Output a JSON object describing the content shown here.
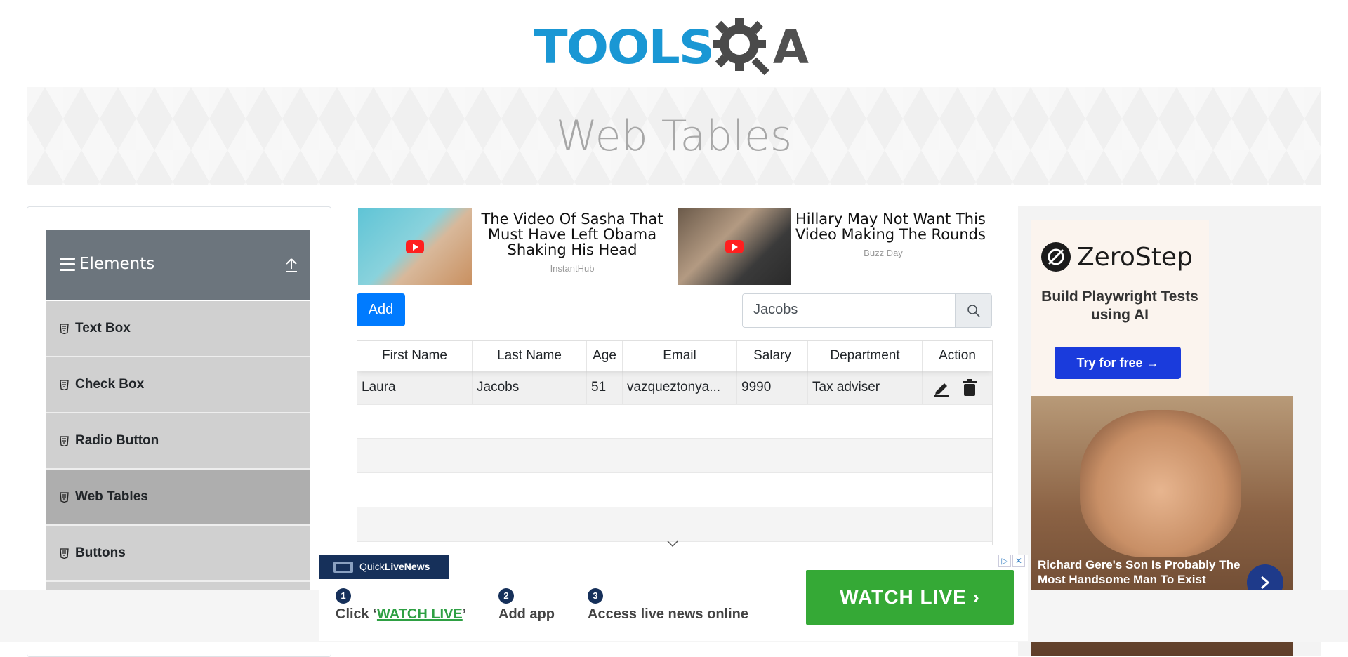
{
  "logo": {
    "text": "TOOLS",
    "suffix": "A"
  },
  "banner": {
    "title": "Web Tables"
  },
  "sidebar": {
    "group": {
      "title": "Elements"
    },
    "items": [
      {
        "label": "Text Box",
        "active": false
      },
      {
        "label": "Check Box",
        "active": false
      },
      {
        "label": "Radio Button",
        "active": false
      },
      {
        "label": "Web Tables",
        "active": true
      },
      {
        "label": "Buttons",
        "active": false
      }
    ]
  },
  "ads": [
    {
      "title": "The Video Of Sasha That Must Have Left Obama Shaking His Head",
      "source": "InstantHub"
    },
    {
      "title": "Hillary May Not Want This Video Making The Rounds",
      "source": "Buzz Day"
    }
  ],
  "toolbar": {
    "add_label": "Add"
  },
  "search": {
    "value": "Jacobs"
  },
  "table": {
    "columns": [
      "First Name",
      "Last Name",
      "Age",
      "Email",
      "Salary",
      "Department",
      "Action"
    ],
    "rows": [
      {
        "first": "Laura",
        "last": "Jacobs",
        "age": "51",
        "email": "vazqueztonya...",
        "salary": "9990",
        "department": "Tax adviser"
      }
    ]
  },
  "right_ad": {
    "brand": "ZeroStep",
    "headline": "Build Playwright Tests using AI",
    "cta": "Try for free →",
    "photo_caption": "Richard Gere's Son Is Probably The Most Handsome Man To Exist"
  },
  "bottom_ad": {
    "brand_prefix": "Quick",
    "brand_bold": "LiveNews",
    "steps": [
      {
        "num": "1",
        "pre": "Click ‘",
        "link": "WATCH LIVE",
        "post": "’"
      },
      {
        "num": "2",
        "text": "Add app"
      },
      {
        "num": "3",
        "text": "Access live news online"
      }
    ],
    "cta": "WATCH LIVE  ›"
  },
  "colors": {
    "accent": "#007bff",
    "logo_blue": "#1a97d4",
    "header_gray": "#6c757d",
    "watch_green": "#35a936"
  }
}
